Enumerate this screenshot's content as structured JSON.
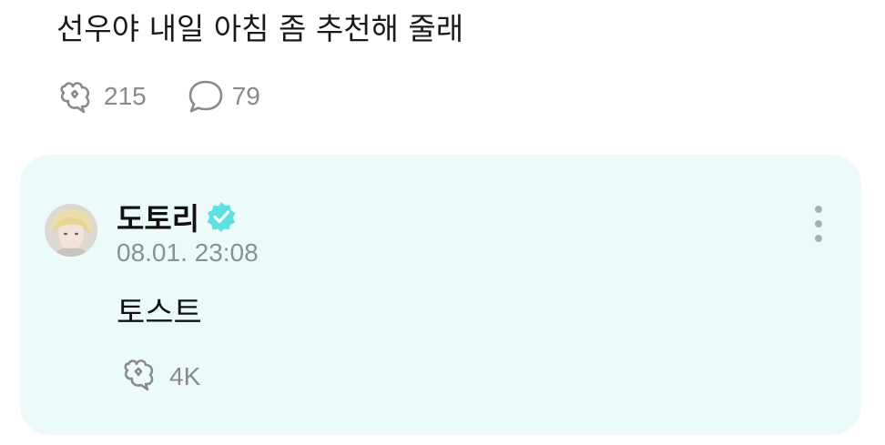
{
  "post": {
    "text": "선우야 내일 아침 좀 추천해 줄래",
    "likes": "215",
    "comments": "79"
  },
  "reply": {
    "author": "도토리",
    "timestamp": "08.01. 23:08",
    "text": "토스트",
    "likes": "4K"
  },
  "icons": {
    "like": "heart-cluster-icon",
    "comment": "speech-bubble-icon",
    "verified": "verified-badge-icon",
    "more": "more-vertical-icon"
  },
  "colors": {
    "card_background": "#ecfbf9",
    "verified_badge": "#5ee0e0",
    "muted_text": "#8a8a8a"
  }
}
